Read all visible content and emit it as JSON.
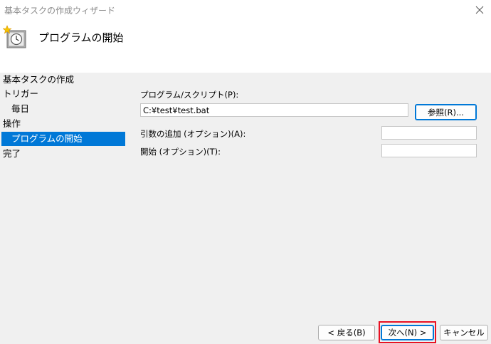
{
  "window": {
    "title": "基本タスクの作成ウィザード"
  },
  "header": {
    "title": "プログラムの開始",
    "icon": "clock-icon"
  },
  "nav": {
    "items": [
      {
        "label": "基本タスクの作成"
      },
      {
        "label": "トリガー"
      },
      {
        "label": "毎日"
      },
      {
        "label": "操作"
      },
      {
        "label": "プログラムの開始",
        "selected": true
      },
      {
        "label": "完了"
      }
    ]
  },
  "form": {
    "program_label": "プログラム/スクリプト(P):",
    "program_value": "C:¥test¥test.bat",
    "browse_label": "参照(R)...",
    "args_label": "引数の追加 (オプション)(A):",
    "args_value": "",
    "start_label": "開始 (オプション)(T):",
    "start_value": ""
  },
  "footer": {
    "back_label": "< 戻る(B)",
    "next_label": "次へ(N) >",
    "cancel_label": "キャンセル"
  },
  "colors": {
    "selection": "#0078d7",
    "panel_bg": "#f0f0f0",
    "highlight": "#e81123"
  }
}
